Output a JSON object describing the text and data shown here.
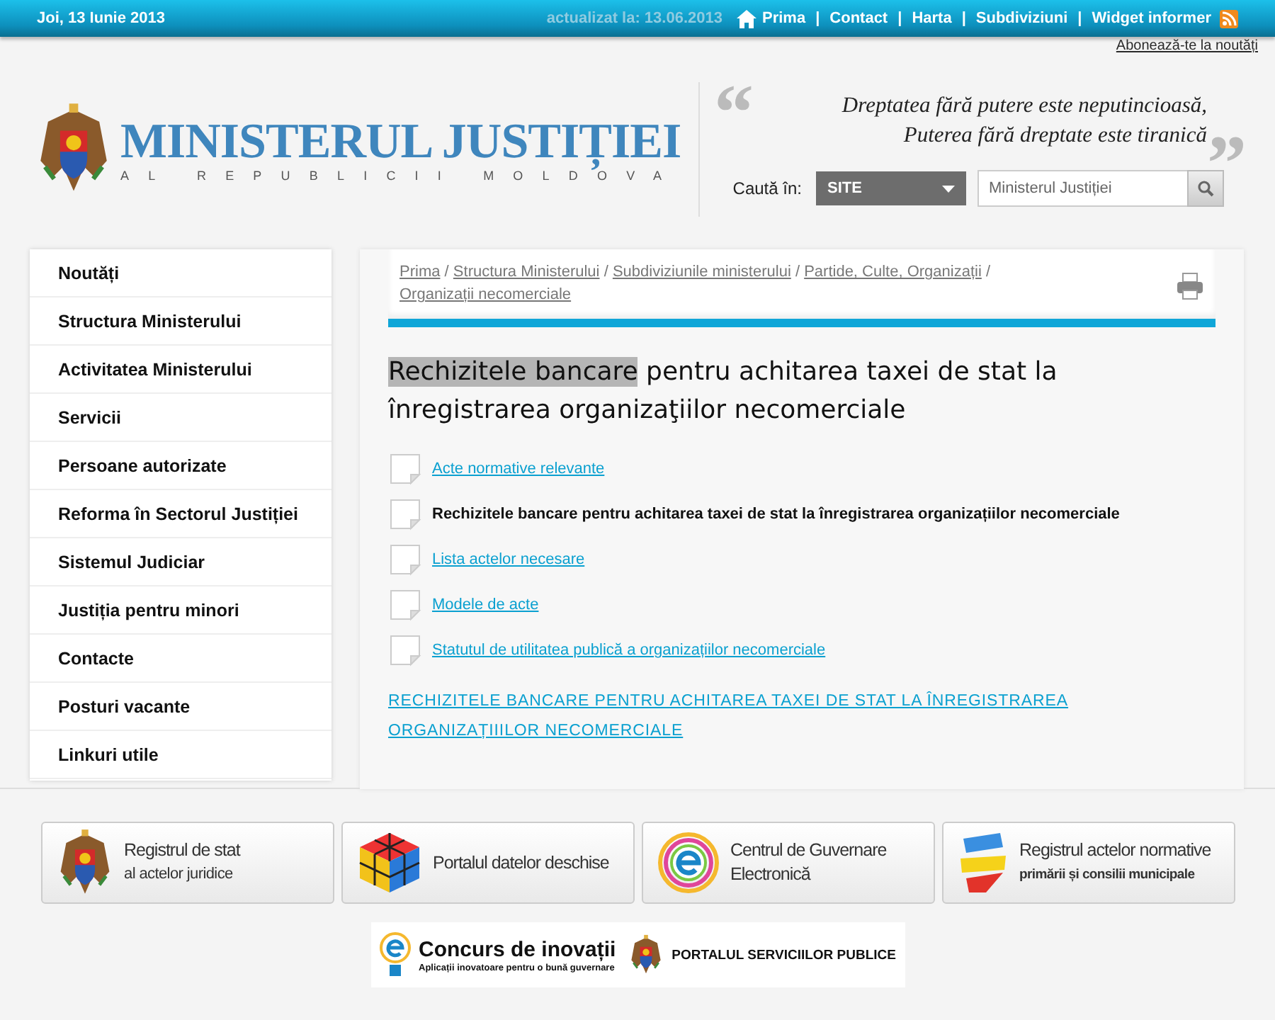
{
  "top_bar": {
    "date": "Joi, 13 Iunie 2013",
    "updated": "actualizat la: 13.06.2013",
    "separator": "|",
    "links": [
      "Prima",
      "Contact",
      "Harta",
      "Subdiviziuni",
      "Widget informer"
    ],
    "subscribe": "Abonează-te la noutăți"
  },
  "header": {
    "logo_title": "MINISTERUL JUSTIȚIEI",
    "logo_subtitle": "AL REPUBLICII MOLDOVA",
    "quote": [
      "Dreptatea fără putere este neputincioasă,",
      "Puterea fără dreptate este tiranică"
    ],
    "quote_open": "“",
    "quote_close": "”",
    "search": {
      "label": "Caută în:",
      "scope": "SITE",
      "placeholder": "Ministerul Justiției"
    }
  },
  "sidebar": {
    "items": [
      "Noutăți",
      "Structura Ministerului",
      "Activitatea Ministerului",
      "Servicii",
      "Persoane autorizate",
      "Reforma în Sectorul Justiției",
      "Sistemul Judiciar",
      "Justiția pentru minori",
      "Contacte",
      "Posturi vacante",
      "Linkuri utile"
    ]
  },
  "breadcrumb": {
    "separator": "/",
    "items": [
      "Prima",
      "Structura Ministerului",
      "Subdiviziunile ministerului",
      "Partide, Culte, Organizații",
      "Organizații necomerciale"
    ]
  },
  "title_parts": [
    {
      "text": "Rechizitele bancare",
      "highlighted": true
    },
    {
      "text": " pentru achitarea taxei de stat la înregistrarea organizaţiilor necomerciale",
      "highlighted": false
    }
  ],
  "documents": [
    {
      "label": "Acte normative relevante",
      "selected": false
    },
    {
      "label": "Rechizitele bancare pentru achitarea taxei de stat la înregistrarea organizațiilor necomerciale",
      "selected": true
    },
    {
      "label": "Lista actelor necesare",
      "selected": false
    },
    {
      "label": "Modele de acte",
      "selected": false
    },
    {
      "label": "Statutul de utilitatea publică a organizațiilor necomerciale",
      "selected": false
    }
  ],
  "full_link": "RECHIZITELE BANCARE PENTRU ACHITAREA TAXEI DE STAT LA ÎNREGISTRAREA ORGANIZAȚIIILOR NECOMERCIALE",
  "banners": [
    {
      "kind": "arms",
      "title": "Registrul de stat",
      "subtitle": "al actelor juridice"
    },
    {
      "kind": "cube",
      "title": "Portalul datelor deschise"
    },
    {
      "kind": "e",
      "title": "Centrul de Guvernare Electronică"
    },
    {
      "kind": "ribbons",
      "title": "Registrul actelor normative",
      "subtitle": "primării și consilii municipale"
    }
  ],
  "promo": {
    "title": "Concurs de inovații",
    "subtitle": "Aplicații inovatoare pentru o bună guvernare",
    "portal": "PORTALUL SERVICIILOR PUBLICE"
  }
}
